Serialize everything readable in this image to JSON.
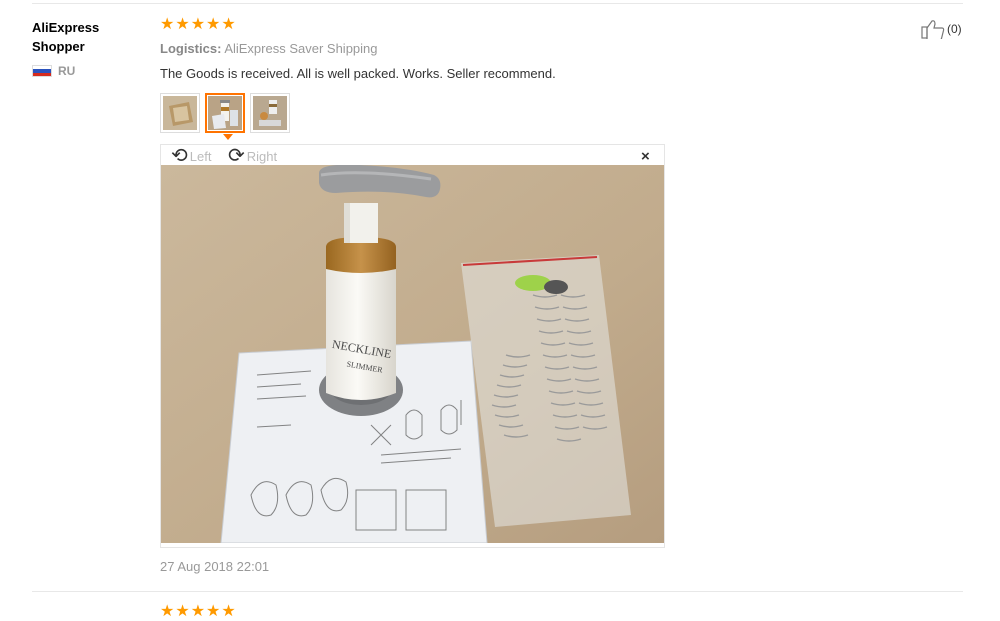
{
  "review": {
    "user_name": "AliExpress Shopper",
    "country_code": "RU",
    "rating": 5,
    "logistics_label": "Logistics:",
    "logistics_value": "AliExpress Saver Shipping",
    "text": "The Goods is received. All is well packed. Works. Seller recommend.",
    "date": "27 Aug 2018 22:01",
    "helpful_count": "(0)"
  },
  "viewer": {
    "rotate_left_label": "Left",
    "rotate_right_label": "Right",
    "close_glyph": "×",
    "photo_product_text_1": "NECKLINE",
    "photo_product_text_2": "SLIMMER"
  },
  "colors": {
    "star": "#ff9a00",
    "active_thumb_border": "#ff7300",
    "muted_text": "#999999"
  },
  "icons": [
    "star-icon",
    "russia-flag-icon",
    "rotate-left-icon",
    "rotate-right-icon",
    "close-icon",
    "thumbs-up-icon"
  ]
}
